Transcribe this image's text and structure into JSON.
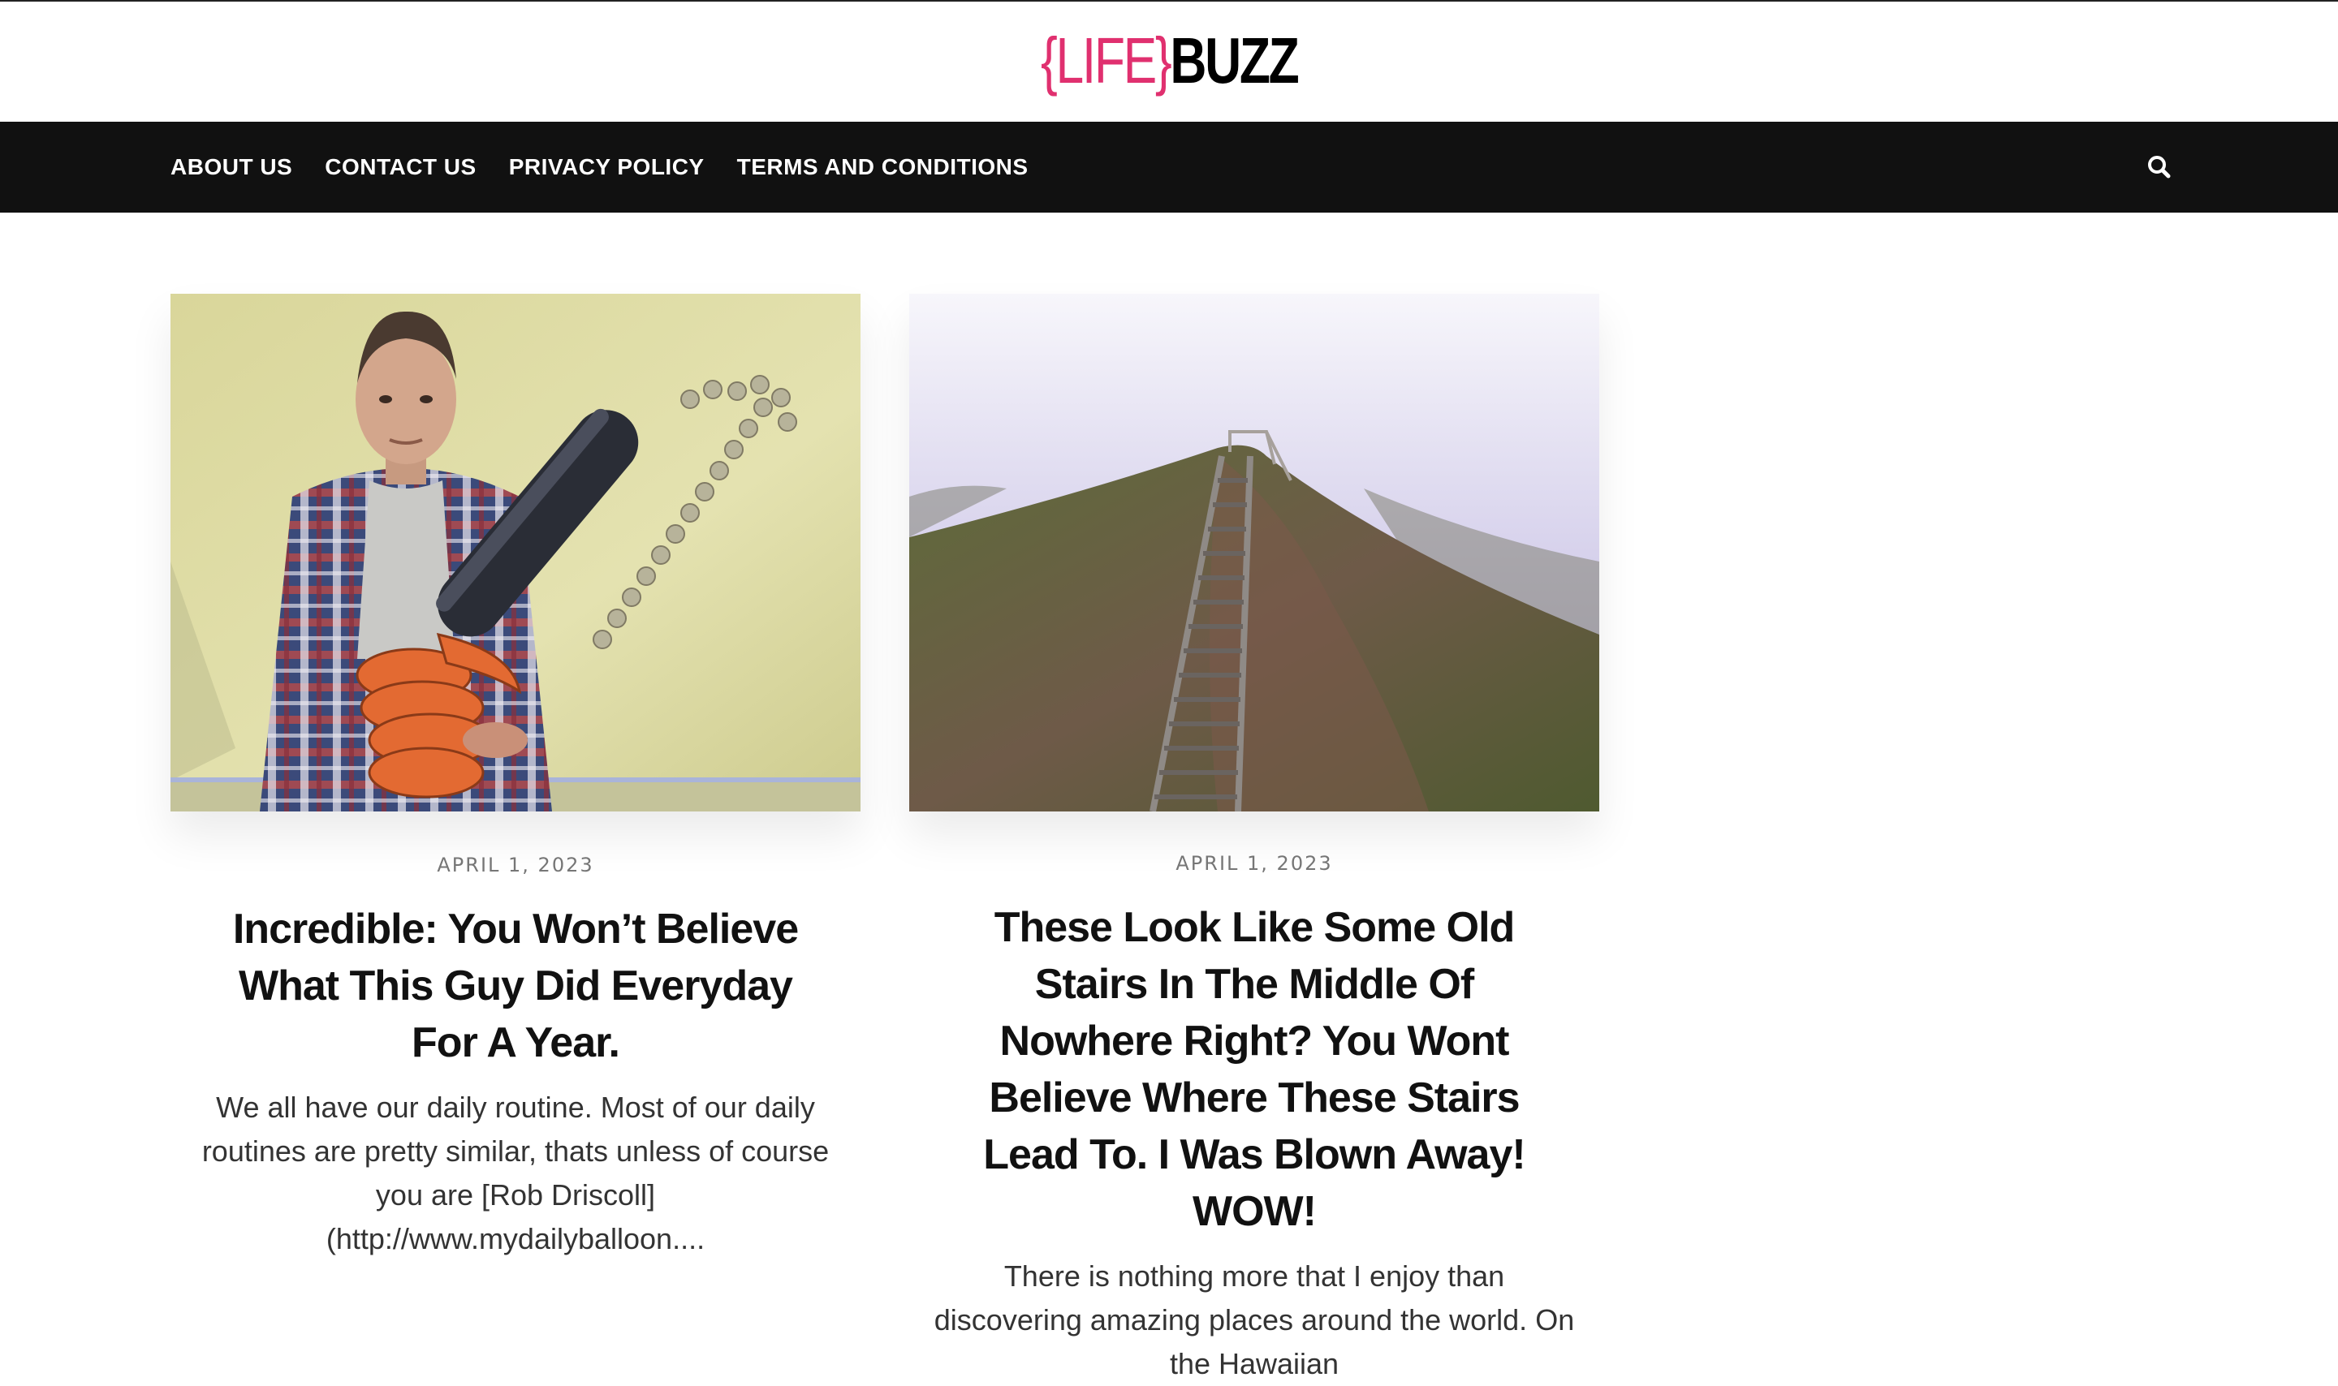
{
  "brand": {
    "logo_open": "{",
    "logo_life": "LIFE",
    "logo_close": "}",
    "logo_buzz": "BUZZ",
    "accent_color": "#e0306f"
  },
  "nav": {
    "items": [
      {
        "label": "ABOUT US"
      },
      {
        "label": "CONTACT US"
      },
      {
        "label": "PRIVACY POLICY"
      },
      {
        "label": "TERMS AND CONDITIONS"
      }
    ],
    "search_icon": "search-icon",
    "background": "#111111"
  },
  "posts": [
    {
      "date": "APRIL 1, 2023",
      "title": "Incredible: You Won’t Believe What This Guy Did Everyday For A Year.",
      "excerpt": "We all have our daily routine. Most of our daily routines are pretty similar, thats unless of course you are [Rob Driscoll](http://www.mydailyballoon....",
      "image": "man-with-balloon-chainsaw-image"
    },
    {
      "date": "APRIL 1, 2023",
      "title": "These Look Like Some Old Stairs In The Middle Of Nowhere Right? You Wont Believe Where These Stairs Lead To. I Was Blown Away! WOW!",
      "excerpt": "There is nothing more that I enjoy than discovering amazing places around the world. On the Hawaiian",
      "image": "mountain-stairs-image"
    }
  ]
}
